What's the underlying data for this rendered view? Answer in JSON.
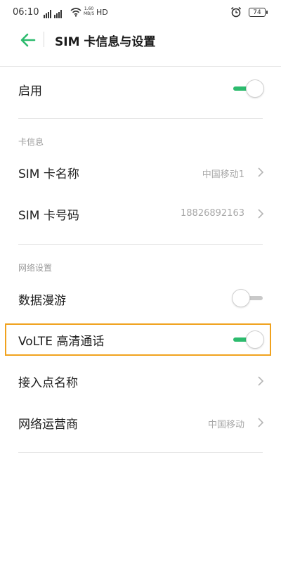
{
  "status_bar": {
    "time": "06:10",
    "network_speed_value": "1.60",
    "network_speed_unit": "MB/S",
    "hd": "HD",
    "battery": "74"
  },
  "header": {
    "title": "SIM 卡信息与设置"
  },
  "rows": {
    "enable": {
      "label": "启用",
      "enabled": true
    },
    "card_info_section": "卡信息",
    "sim_name": {
      "label": "SIM 卡名称",
      "value": "中国移动1"
    },
    "sim_number": {
      "label": "SIM 卡号码",
      "value": "18826892163"
    },
    "network_section": "网络设置",
    "data_roaming": {
      "label": "数据漫游",
      "enabled": false
    },
    "volte": {
      "label": "VoLTE 高清通话",
      "enabled": true
    },
    "apn": {
      "label": "接入点名称"
    },
    "carrier": {
      "label": "网络运营商",
      "value": "中国移动"
    }
  },
  "colors": {
    "accent": "#2dbb6e",
    "highlight": "#f0a21e"
  }
}
